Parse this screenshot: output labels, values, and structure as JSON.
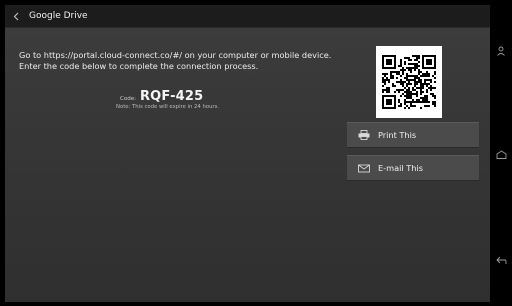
{
  "header": {
    "back_icon": "chevron-left-icon",
    "title": "Google Drive"
  },
  "instructions": {
    "line1": "Go to https://portal.cloud-connect.co/#/ on your computer or mobile device.",
    "line2": "Enter the code below to complete the connection process."
  },
  "code": {
    "label": "Code:",
    "value": "RQF-425",
    "note": "Note: This code will expire in 24 hours."
  },
  "qr": {
    "icon": "qr-code"
  },
  "actions": [
    {
      "label": "Print This",
      "icon": "printer-icon"
    },
    {
      "label": "E-mail This",
      "icon": "envelope-icon"
    }
  ],
  "nav": {
    "items": [
      "person-icon",
      "home-icon",
      "back-arrow-icon"
    ]
  },
  "colors": {
    "background": "#363636",
    "titlebar": "#1c1c1c",
    "button": "#4b4b4b"
  }
}
